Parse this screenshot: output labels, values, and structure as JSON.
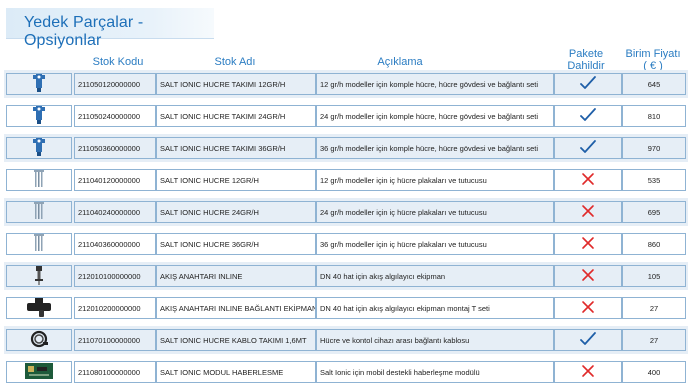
{
  "title": "Yedek Parçalar - Opsiyonlar",
  "headers": {
    "code": "Stok Kodu",
    "name": "Stok Adı",
    "desc": "Açıklama",
    "pkg_line1": "Pakete",
    "pkg_line2": "Dahildir",
    "price_line1": "Birim Fiyatı",
    "price_line2": "( € )"
  },
  "rows": [
    {
      "code": "211050120000000",
      "name": "SALT IONIC HUCRE TAKIMI 12GR/H",
      "desc": "12 gr/h modeller için komple hücre, hücre gövdesi ve bağlantı seti",
      "included": true,
      "price": "645",
      "icon": "complete-cell-icon"
    },
    {
      "code": "211050240000000",
      "name": "SALT IONIC HUCRE TAKIMI 24GR/H",
      "desc": "24 gr/h modeller için komple hücre, hücre gövdesi ve bağlantı seti",
      "included": true,
      "price": "810",
      "icon": "complete-cell-icon"
    },
    {
      "code": "211050360000000",
      "name": "SALT IONIC HUCRE TAKIMI 36GR/H",
      "desc": "36 gr/h modeller için komple hücre, hücre gövdesi ve bağlantı seti",
      "included": true,
      "price": "970",
      "icon": "complete-cell-icon"
    },
    {
      "code": "211040120000000",
      "name": "SALT IONIC HUCRE 12GR/H",
      "desc": "12 gr/h modeller için iç hücre plakaları ve tutucusu",
      "included": false,
      "price": "535",
      "icon": "inner-cell-icon"
    },
    {
      "code": "211040240000000",
      "name": "SALT IONIC HUCRE 24GR/H",
      "desc": "24 gr/h modeller için iç hücre plakaları ve tutucusu",
      "included": false,
      "price": "695",
      "icon": "inner-cell-icon"
    },
    {
      "code": "211040360000000",
      "name": "SALT IONIC HUCRE 36GR/H",
      "desc": "36 gr/h modeller için iç hücre plakaları ve tutucusu",
      "included": false,
      "price": "860",
      "icon": "inner-cell-icon"
    },
    {
      "code": "212010100000000",
      "name": "AKIŞ ANAHTARI INLINE",
      "desc": "DN 40 hat için akış algılayıcı ekipman",
      "included": false,
      "price": "105",
      "icon": "flow-switch-icon"
    },
    {
      "code": "212010200000000",
      "name": "AKIŞ ANAHTARI INLINE BAĞLANTI EKİPMANI",
      "desc": "DN 40 hat için akış algılayıcı ekipman montaj T seti",
      "included": false,
      "price": "27",
      "icon": "tee-fitting-icon"
    },
    {
      "code": "211070100000000",
      "name": "SALT IONIC HUCRE KABLO TAKIMI 1,6MT",
      "desc": "Hücre ve kontol cihazı arası  bağlantı kablosu",
      "included": true,
      "price": "27",
      "icon": "cable-icon"
    },
    {
      "code": "211080100000000",
      "name": "SALT IONIC MODUL HABERLESME",
      "desc": "Salt Ionic için mobil destekli haberleşme modülü",
      "included": false,
      "price": "400",
      "icon": "circuit-board-icon"
    }
  ],
  "colors": {
    "accent": "#2a7cc2",
    "check": "#1f5fa8",
    "cross": "#e02a2a",
    "row_band": "#e6eef6"
  }
}
